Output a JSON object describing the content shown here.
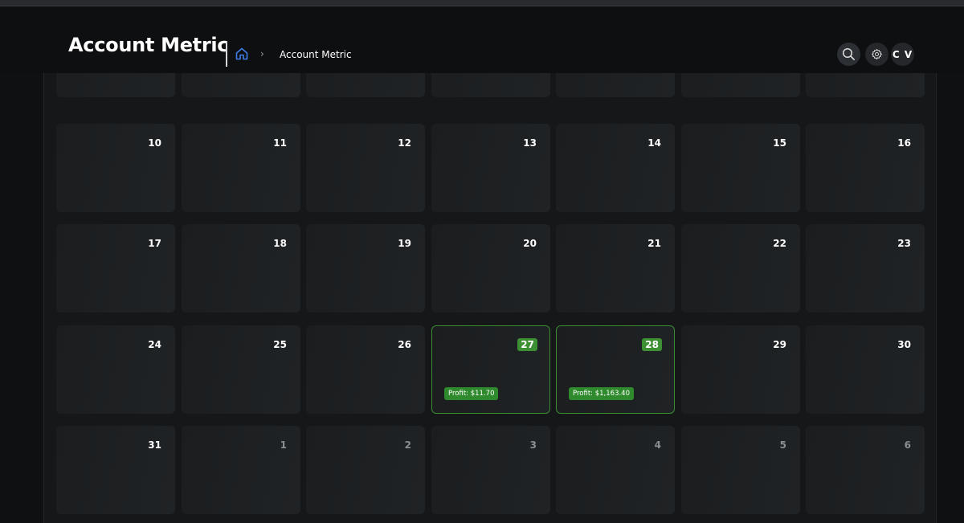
{
  "header": {
    "title": "Account Metric",
    "breadcrumb": {
      "home_icon": "home-icon",
      "separator": "›",
      "current": "Account Metric"
    },
    "actions": {
      "search_icon": "search-icon",
      "settings_icon": "gear-icon",
      "avatar_initials": "C V"
    }
  },
  "colors": {
    "background": "#0f1012",
    "cell": "#1d2022",
    "accent_green": "#3d8f33",
    "home_icon_blue": "#3f7ee8"
  },
  "calendar": {
    "weeks": [
      {
        "days": [
          {
            "day": ""
          },
          {
            "day": ""
          },
          {
            "day": ""
          },
          {
            "day": ""
          },
          {
            "day": ""
          },
          {
            "day": ""
          },
          {
            "day": ""
          }
        ]
      },
      {
        "days": [
          {
            "day": "10"
          },
          {
            "day": "11"
          },
          {
            "day": "12"
          },
          {
            "day": "13"
          },
          {
            "day": "14"
          },
          {
            "day": "15"
          },
          {
            "day": "16"
          }
        ]
      },
      {
        "days": [
          {
            "day": "17"
          },
          {
            "day": "18"
          },
          {
            "day": "19"
          },
          {
            "day": "20"
          },
          {
            "day": "21"
          },
          {
            "day": "22"
          },
          {
            "day": "23"
          }
        ]
      },
      {
        "days": [
          {
            "day": "24"
          },
          {
            "day": "25"
          },
          {
            "day": "26"
          },
          {
            "day": "27",
            "profit": "Profit: $11.70"
          },
          {
            "day": "28",
            "profit": "Profit: $1,163.40"
          },
          {
            "day": "29"
          },
          {
            "day": "30"
          }
        ]
      },
      {
        "days": [
          {
            "day": "31"
          },
          {
            "day": "1",
            "muted": true
          },
          {
            "day": "2",
            "muted": true
          },
          {
            "day": "3",
            "muted": true
          },
          {
            "day": "4",
            "muted": true
          },
          {
            "day": "5",
            "muted": true
          },
          {
            "day": "6",
            "muted": true
          }
        ]
      }
    ]
  }
}
